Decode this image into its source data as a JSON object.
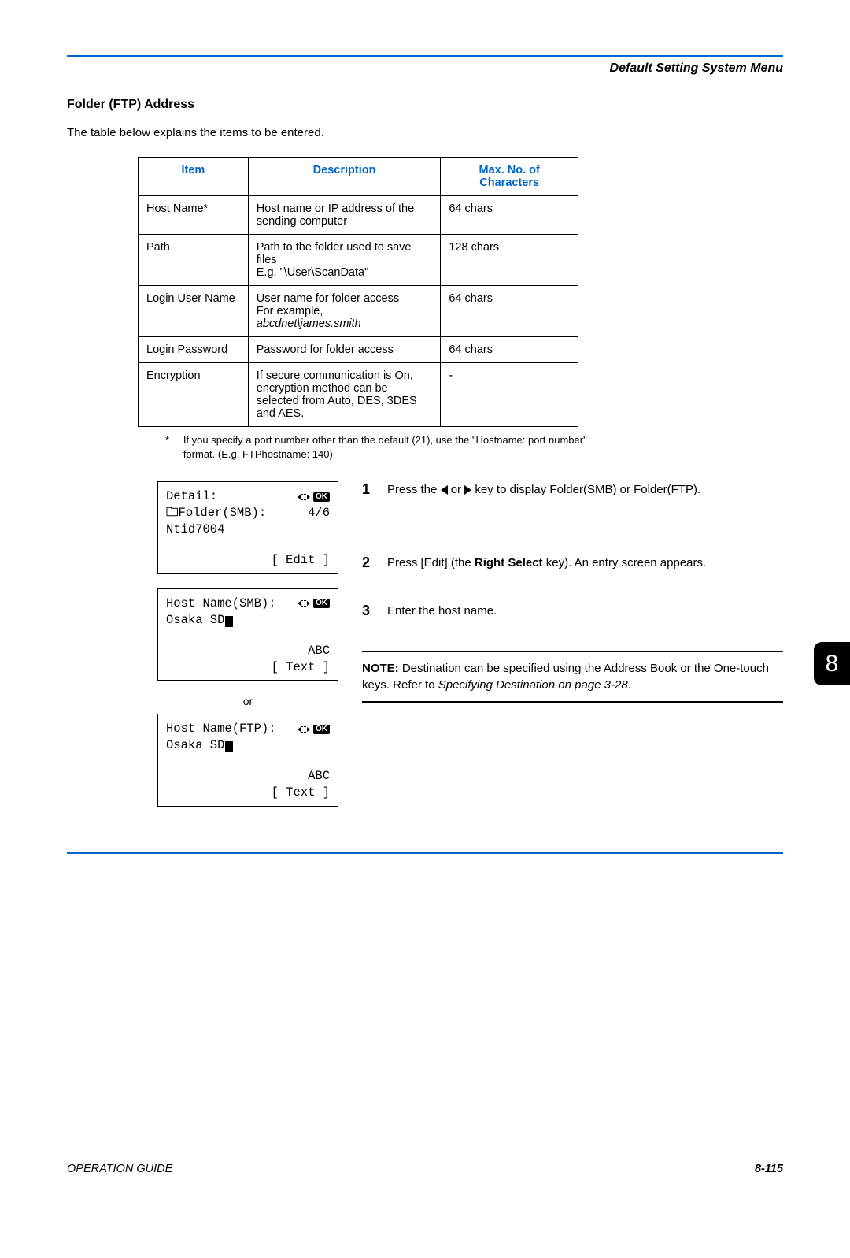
{
  "header": {
    "breadcrumb": "Default Setting System Menu"
  },
  "section": {
    "heading": "Folder (FTP) Address",
    "intro": "The table below explains the items to be entered."
  },
  "table": {
    "headers": {
      "item": "Item",
      "description": "Description",
      "max": "Max. No. of Characters"
    },
    "rows": [
      {
        "item": "Host Name*",
        "description": "Host name or IP address of the sending computer",
        "max": "64 chars"
      },
      {
        "item": "Path",
        "description": "Path to the folder used to save files\nE.g. \"\\User\\ScanData\"",
        "max": "128 chars"
      },
      {
        "item": "Login User Name",
        "description": "User name for folder access\nFor example,",
        "description_italic": "abcdnet\\james.smith",
        "max": "64 chars"
      },
      {
        "item": "Login Password",
        "description": "Password for folder access",
        "max": "64 chars"
      },
      {
        "item": "Encryption",
        "description": "If secure communication is On, encryption method can be selected from Auto, DES, 3DES and AES.",
        "max": "-"
      }
    ]
  },
  "footnote": {
    "mark": "*",
    "text": "If you specify a port number other than the default (21), use the \"Hostname: port number\" format. (E.g. FTPhostname: 140)"
  },
  "chapter_tab": "8",
  "lcd1": {
    "title": "Detail:",
    "label": "Folder(SMB):",
    "pager": "4/6",
    "value": "Ntid7004",
    "softkey": "[  Edit   ]"
  },
  "lcd2": {
    "title": "Host Name(SMB):",
    "value": "Osaka SD",
    "mode": "ABC",
    "softkey": "[  Text   ]"
  },
  "or_label": "or",
  "lcd3": {
    "title": "Host Name(FTP):",
    "value": "Osaka SD",
    "mode": "ABC",
    "softkey": "[  Text   ]"
  },
  "steps": {
    "s1": {
      "num": "1",
      "pre": "Press the ",
      "mid": " or ",
      "post": " key to display Folder(SMB) or Folder(FTP)."
    },
    "s2": {
      "num": "2",
      "pre": "Press [Edit] (the ",
      "bold": "Right Select",
      "post": " key). An entry screen appears."
    },
    "s3": {
      "num": "3",
      "text": "Enter the host name."
    }
  },
  "note": {
    "label": "NOTE:",
    "text": " Destination can be specified using the Address Book or the One-touch keys. Refer to ",
    "ref": "Specifying Destination on page 3-28",
    "tail": "."
  },
  "footer": {
    "guide": "OPERATION GUIDE",
    "page": "8-115"
  },
  "ok_label": "OK"
}
